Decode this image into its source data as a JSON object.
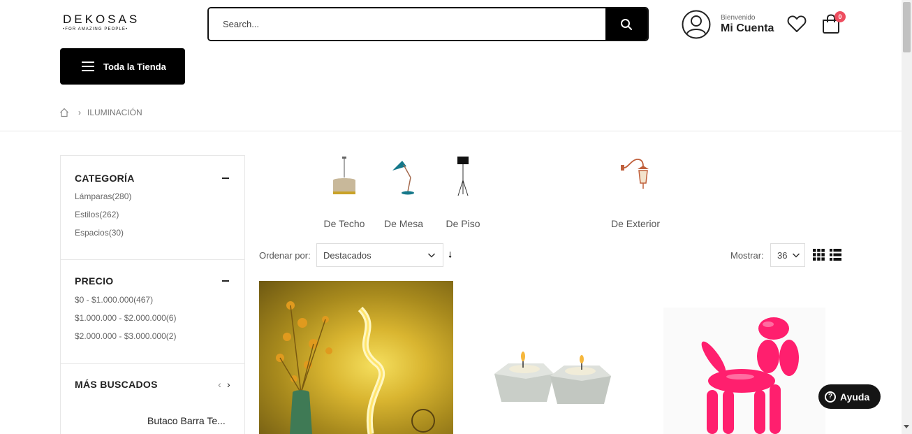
{
  "header": {
    "logo_main": "DEKOSAS",
    "logo_sub": "•FOR AMAZING PEOPLE•",
    "search_placeholder": "Search...",
    "account_welcome": "Bienvenido",
    "account_name": "Mi Cuenta",
    "cart_count": "0"
  },
  "nav": {
    "store_button": "Toda la Tienda"
  },
  "breadcrumb": {
    "current": "ILUMINACIÓN"
  },
  "sidebar": {
    "category_title": "CATEGORÍA",
    "categories": [
      "Lámparas(280)",
      "Estilos(262)",
      "Espacios(30)"
    ],
    "price_title": "PRECIO",
    "prices": [
      "$0 - $1.000.000(467)",
      "$1.000.000 - $2.000.000(6)",
      "$2.000.000 - $3.000.000(2)"
    ],
    "most_searched_title": "MÁS BUSCADOS",
    "most_searched_item": "Butaco Barra Te..."
  },
  "categories_bar": [
    "De Techo",
    "De Mesa",
    "De Piso",
    "De Exterior"
  ],
  "toolbar": {
    "sort_label": "Ordenar por:",
    "sort_value": "Destacados",
    "show_label": "Mostrar:",
    "show_value": "36"
  },
  "help": {
    "label": "Ayuda"
  }
}
